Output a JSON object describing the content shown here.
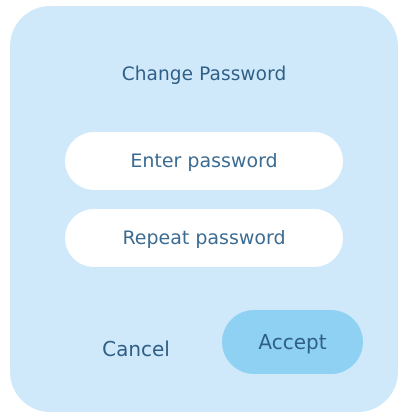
{
  "dialog": {
    "title": "Change Password",
    "fields": {
      "password_placeholder": "Enter password",
      "repeat_password_placeholder": "Repeat password"
    },
    "actions": {
      "cancel_label": "Cancel",
      "accept_label": "Accept"
    },
    "colors": {
      "dialog_background": "#cfe9fb",
      "accent_button": "#8ed1f2",
      "text": "#2f5f86",
      "field_background": "#ffffff"
    }
  }
}
